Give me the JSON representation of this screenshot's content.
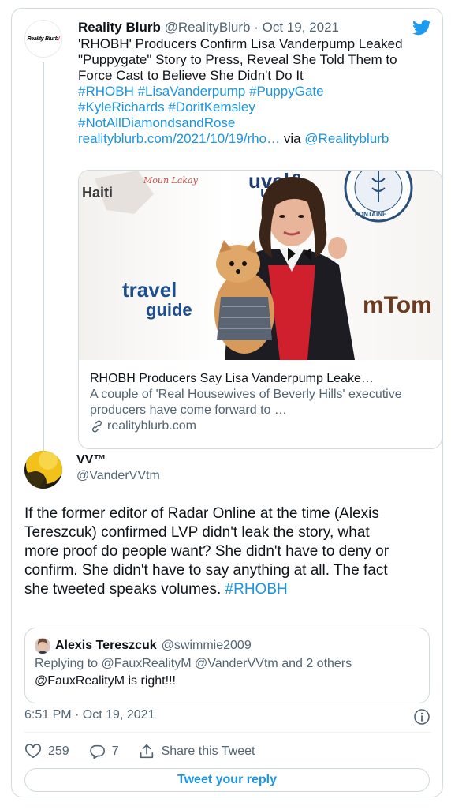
{
  "parent_tweet": {
    "author_name": "Reality Blurb",
    "author_handle": "@RealityBlurb",
    "separator": "·",
    "date": "Oct 19, 2021",
    "avatar_logo_text": "RealityBlurb",
    "text": "'RHOBH' Producers Confirm Lisa Vanderpump Leaked \"Puppygate\" Story to Press, Reveal She Told Them to Force Cast to Believe She Didn't Do It",
    "hashtags": [
      "#RHOBH",
      "#LisaVanderpump",
      "#PuppyGate",
      "#KyleRichards",
      "#DoritKemsley",
      "#NotAllDiamondsandRose"
    ],
    "link_text": "realityblurb.com/2021/10/19/rho…",
    "via_text": "via",
    "via_handle": "@Realityblurb",
    "media": {
      "photo_texts": [
        "Haiti",
        "Moun Lakay",
        "travel",
        "guide",
        "mTom",
        "FONTAINE"
      ],
      "title": "RHOBH Producers Say Lisa Vanderpump Leake…",
      "description": "A couple of 'Real Housewives of Beverly Hills' executive producers have come forward to …",
      "domain": "realityblurb.com",
      "domain_icon": "link-icon"
    }
  },
  "reply_tweet": {
    "author_name": "VV™",
    "author_handle": "@VanderVVtm",
    "text": "If the former editor of Radar Online at the time (Alexis Tereszcuk) confirmed LVP didn't leak the story, what more proof do people want? She didn't have to deny or confirm. She didn't have to say anything at all. The fact she tweeted speaks volumes.",
    "hashtag": "#RHOBH",
    "quoted": {
      "author_name": "Alexis Tereszcuk",
      "author_handle": "@swimmie2009",
      "replying_to": "Replying to @FauxRealityM @VanderVVtm and 2 others",
      "text": "@FauxRealityM is right!!!"
    },
    "timestamp": "6:51 PM · Oct 19, 2021",
    "likes": "259",
    "replies": "7",
    "share_label": "Share this Tweet",
    "reply_button_label": "Tweet your reply"
  },
  "icons": {
    "brand": "twitter-bird-icon",
    "info": "info-icon",
    "like": "heart-icon",
    "reply": "reply-bubble-icon",
    "share": "share-icon"
  },
  "colors": {
    "link": "#1b95e0",
    "secondary_text": "#536471",
    "border": "#cfd9de",
    "twitter_blue": "#1d9bf0"
  }
}
